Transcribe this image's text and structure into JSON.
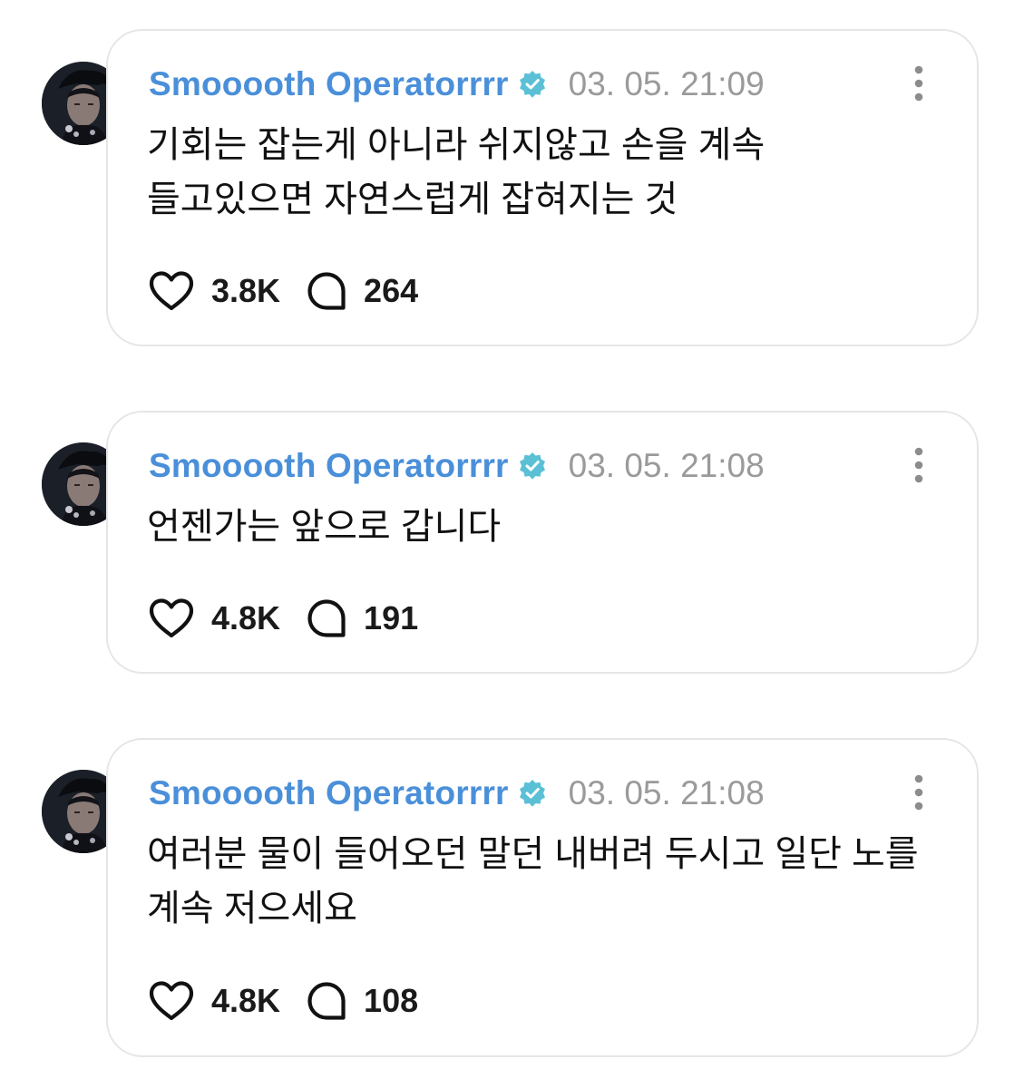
{
  "posts": [
    {
      "username": "Smooooth Operatorrrr",
      "timestamp": "03. 05. 21:09",
      "text_lines": [
        "기회는 잡는게 아니라 쉬지않고 손을 계속",
        "들고있으면 자연스럽게 잡혀지는 것"
      ],
      "likes": "3.8K",
      "comments": "264"
    },
    {
      "username": "Smooooth Operatorrrr",
      "timestamp": "03. 05. 21:08",
      "text_lines": [
        "언젠가는 앞으로 갑니다"
      ],
      "likes": "4.8K",
      "comments": "191"
    },
    {
      "username": "Smooooth Operatorrrr",
      "timestamp": "03. 05. 21:08",
      "text_lines": [
        "여러분 물이 들어오던 말던 내버려 두시고 일단 노를",
        "계속 저으세요"
      ],
      "likes": "4.8K",
      "comments": "108"
    }
  ],
  "icons": {
    "verified": "verified-badge-icon",
    "more": "more-vertical-icon",
    "like": "heart-icon",
    "comment": "comment-bubble-icon"
  },
  "colors": {
    "username": "#4a8fd9",
    "verified": "#5bc0d6",
    "timestamp": "#9a9a9a",
    "border": "#e6e6e6"
  }
}
